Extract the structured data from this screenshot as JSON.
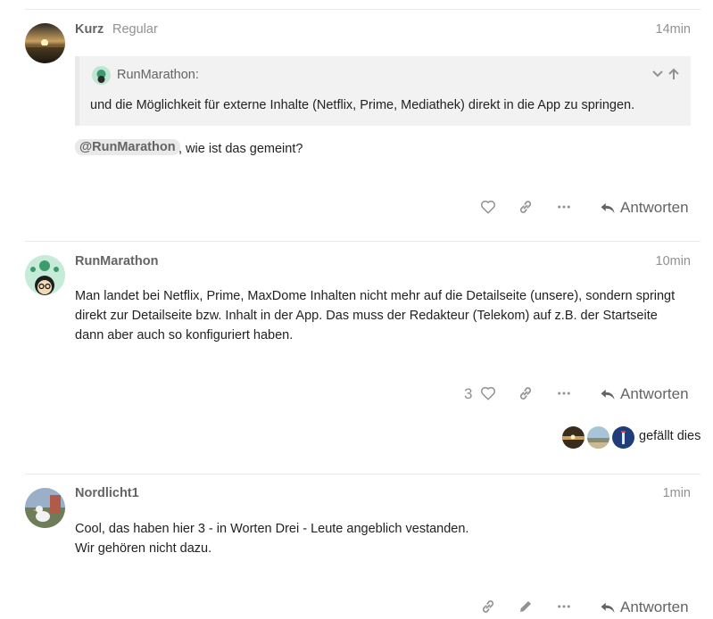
{
  "posts": [
    {
      "username": "Kurz",
      "user_title": "Regular",
      "time": "14min",
      "quote": {
        "username": "RunMarathon:",
        "text": "und die Möglichkeit für externe Inhalte (Netflix, Prime, Mediathek) direkt in die App zu springen."
      },
      "mention": "@RunMarathon",
      "body": ", wie ist das gemeint?",
      "reply_label": "Antworten"
    },
    {
      "username": "RunMarathon",
      "time": "10min",
      "body_lines": [
        "Man landet bei Netflix, Prime, MaxDome Inhalten nicht mehr auf die Detailseite (unsere), sondern springt",
        "direkt zur Detailseite bzw. Inhalt in der App. Das muss der Redakteur (Telekom) auf z.B. der Startseite",
        "dann aber auch so konfiguriert haben."
      ],
      "like_count": "3",
      "reply_label": "Antworten",
      "liked_by_text": "gefällt dies"
    },
    {
      "username": "Nordlicht1",
      "time": "1min",
      "body_lines": [
        "Cool, das haben hier 3 - in Worten Drei - Leute angeblich vestanden.",
        "Wir gehören nicht dazu."
      ],
      "reply_label": "Antworten"
    }
  ],
  "icons": {
    "like": "heart-icon",
    "link": "link-icon",
    "more": "ellipsis-icon",
    "reply": "reply-arrow-icon",
    "edit": "pencil-icon",
    "expand": "chevron-down-icon",
    "go_to_quote": "arrow-up-icon"
  },
  "colors": {
    "muted": "#919191",
    "username": "#646464",
    "quote_bg": "#f2f2f2",
    "divider": "#e9e9e9"
  }
}
